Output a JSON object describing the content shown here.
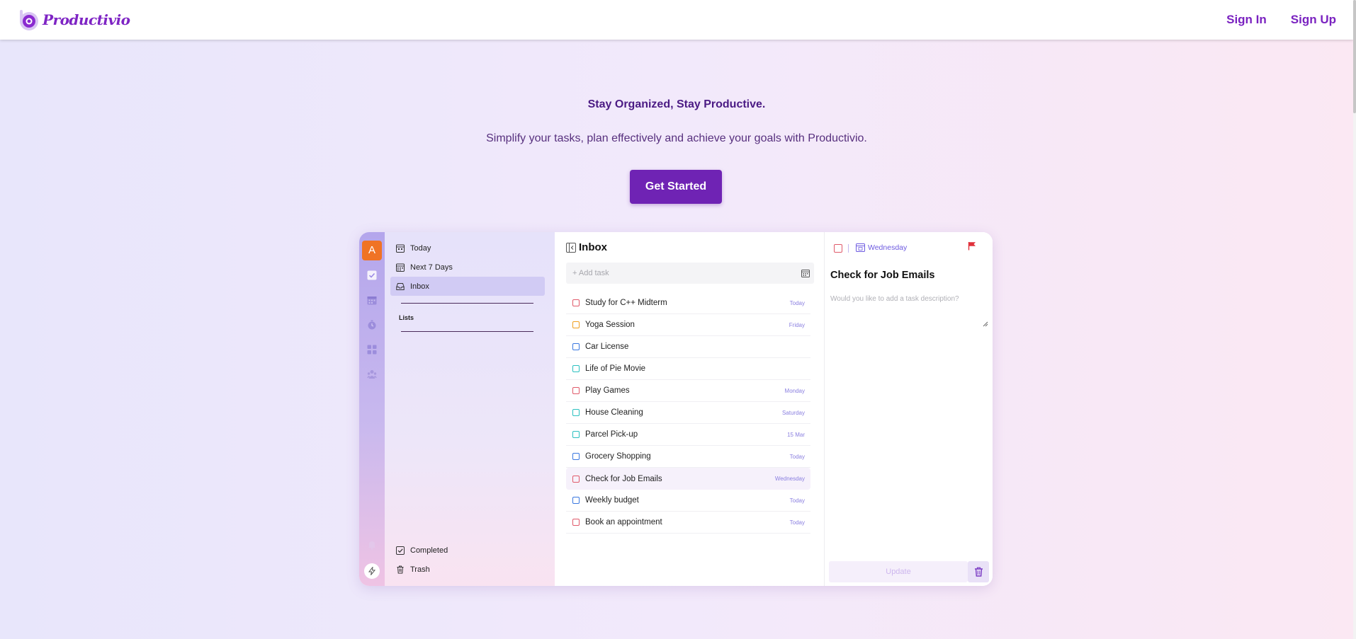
{
  "header": {
    "brand": "Productivio",
    "sign_in": "Sign In",
    "sign_up": "Sign Up"
  },
  "hero": {
    "title": "Stay Organized, Stay Productive.",
    "subtitle": "Simplify your tasks, plan effectively and achieve your goals with Productivio.",
    "cta": "Get Started"
  },
  "app": {
    "avatar_letter": "A",
    "rail_icons": [
      "check-square-icon",
      "calendar-icon",
      "timer-icon",
      "grid-icon",
      "team-icon",
      "bell-icon",
      "bolt-icon"
    ],
    "sidebar": {
      "items": [
        {
          "label": "Today",
          "icon": "calendar-today-icon"
        },
        {
          "label": "Next 7 Days",
          "icon": "calendar-week-icon"
        },
        {
          "label": "Inbox",
          "icon": "inbox-icon",
          "active": true
        }
      ],
      "lists_label": "Lists",
      "footer": [
        {
          "label": "Completed",
          "icon": "check-square-icon"
        },
        {
          "label": "Trash",
          "icon": "trash-icon"
        }
      ]
    },
    "main": {
      "title": "Inbox",
      "add_placeholder": "+ Add task",
      "tasks": [
        {
          "title": "Study for C++ Midterm",
          "due": "Today",
          "color": "#e05a6a"
        },
        {
          "title": "Yoga Session",
          "due": "Friday",
          "color": "#f0a020"
        },
        {
          "title": "Car License",
          "due": "",
          "color": "#3a78e0"
        },
        {
          "title": "Life of Pie Movie",
          "due": "",
          "color": "#2bc0c0"
        },
        {
          "title": "Play Games",
          "due": "Monday",
          "color": "#e05a6a"
        },
        {
          "title": "House Cleaning",
          "due": "Saturday",
          "color": "#2bc0c0"
        },
        {
          "title": "Parcel Pick-up",
          "due": "15 Mar",
          "color": "#2bc0c0"
        },
        {
          "title": "Grocery Shopping",
          "due": "Today",
          "color": "#3a78e0"
        },
        {
          "title": "Check for Job Emails",
          "due": "Wednesday",
          "color": "#e05a6a",
          "selected": true
        },
        {
          "title": "Weekly budget",
          "due": "Today",
          "color": "#3a78e0"
        },
        {
          "title": "Book an appointment",
          "due": "Today",
          "color": "#e05a6a"
        }
      ]
    },
    "detail": {
      "date": "Wednesday",
      "title": "Check for Job Emails",
      "description_placeholder": "Would you like to add a task description?",
      "update": "Update",
      "flag_color": "#e0303a"
    }
  },
  "colors": {
    "brand": "#7e24c4",
    "cta": "#6f23b4",
    "avatar": "#f07325",
    "accent": "#8a7fe0"
  }
}
